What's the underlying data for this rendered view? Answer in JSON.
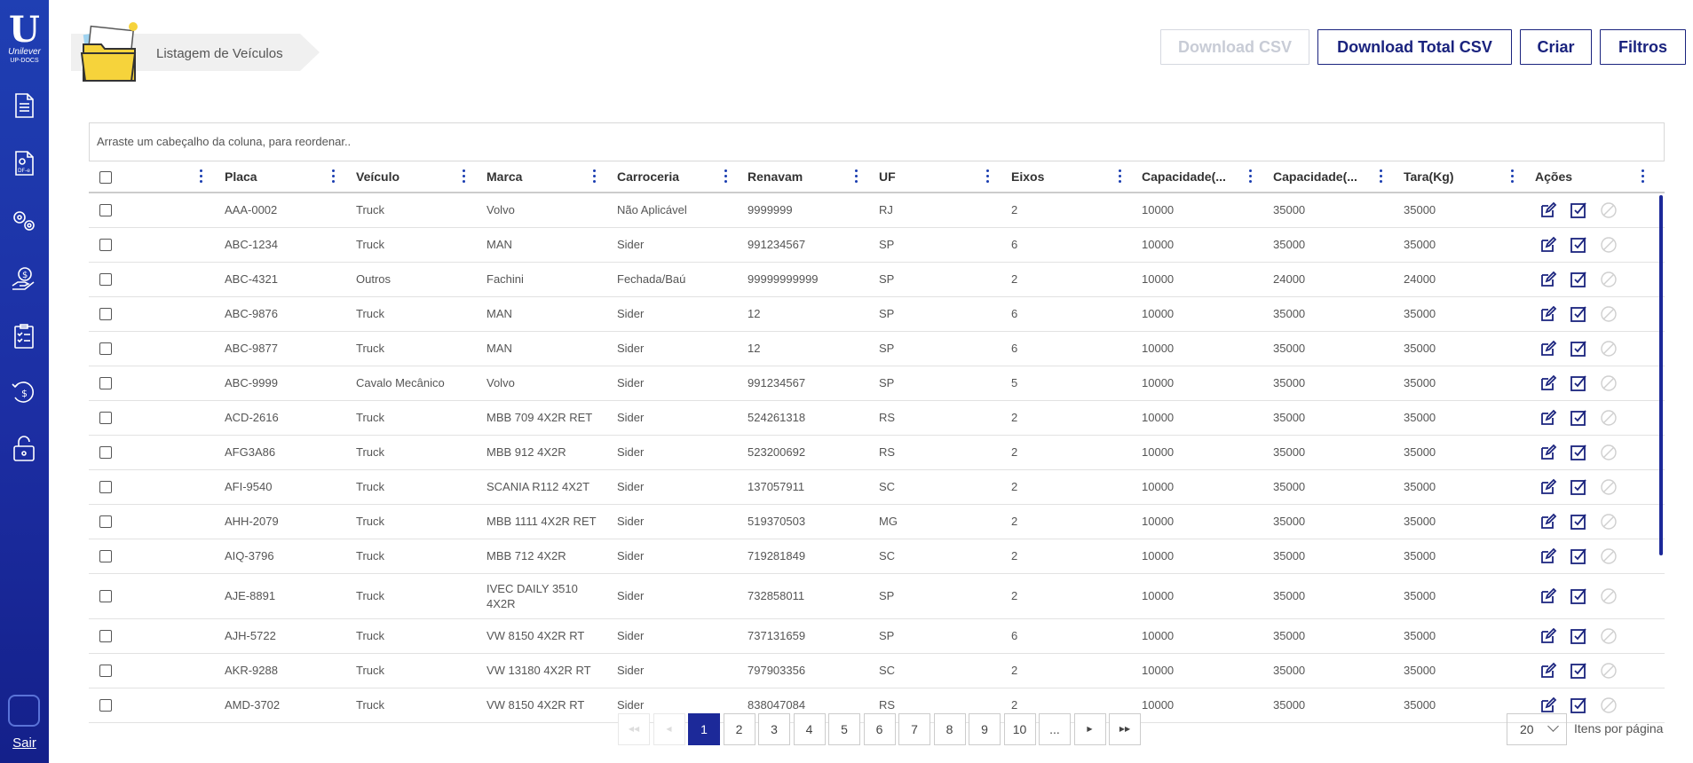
{
  "brand": {
    "name": "Unilever",
    "subtitle": "UP-DOCS",
    "logo_letter": "U"
  },
  "sidebar": {
    "items": [
      {
        "icon": "document-icon"
      },
      {
        "icon": "dfe-document-icon",
        "badge": "DF-e"
      },
      {
        "icon": "settings-gears-icon"
      },
      {
        "icon": "money-hand-icon"
      },
      {
        "icon": "checklist-icon"
      },
      {
        "icon": "refund-dollar-icon"
      },
      {
        "icon": "lock-icon"
      }
    ],
    "exit_label": "Sair"
  },
  "breadcrumb": {
    "title": "Listagem de Veículos"
  },
  "toolbar": {
    "download_csv": "Download CSV",
    "download_total_csv": "Download Total CSV",
    "create": "Criar",
    "filters": "Filtros"
  },
  "grid": {
    "group_panel_text": "Arraste um cabeçalho da coluna, para reordenar..",
    "columns": [
      "Placa",
      "Veículo",
      "Marca",
      "Carroceria",
      "Renavam",
      "UF",
      "Eixos",
      "Capacidade(...",
      "Capacidade(...",
      "Tara(Kg)",
      "Ações"
    ],
    "rows": [
      [
        "AAA-0002",
        "Truck",
        "Volvo",
        "Não Aplicável",
        "9999999",
        "RJ",
        "2",
        "10000",
        "35000",
        "35000"
      ],
      [
        "ABC-1234",
        "Truck",
        "MAN",
        "Sider",
        "991234567",
        "SP",
        "6",
        "10000",
        "35000",
        "35000"
      ],
      [
        "ABC-4321",
        "Outros",
        "Fachini",
        "Fechada/Baú",
        "99999999999",
        "SP",
        "2",
        "10000",
        "24000",
        "24000"
      ],
      [
        "ABC-9876",
        "Truck",
        "MAN",
        "Sider",
        "12",
        "SP",
        "6",
        "10000",
        "35000",
        "35000"
      ],
      [
        "ABC-9877",
        "Truck",
        "MAN",
        "Sider",
        "12",
        "SP",
        "6",
        "10000",
        "35000",
        "35000"
      ],
      [
        "ABC-9999",
        "Cavalo Mecânico",
        "Volvo",
        "Sider",
        "991234567",
        "SP",
        "5",
        "10000",
        "35000",
        "35000"
      ],
      [
        "ACD-2616",
        "Truck",
        "MBB 709 4X2R RET",
        "Sider",
        "524261318",
        "RS",
        "2",
        "10000",
        "35000",
        "35000"
      ],
      [
        "AFG3A86",
        "Truck",
        "MBB 912 4X2R",
        "Sider",
        "523200692",
        "RS",
        "2",
        "10000",
        "35000",
        "35000"
      ],
      [
        "AFI-9540",
        "Truck",
        "SCANIA R112 4X2T",
        "Sider",
        "137057911",
        "SC",
        "2",
        "10000",
        "35000",
        "35000"
      ],
      [
        "AHH-2079",
        "Truck",
        "MBB 1111 4X2R RET",
        "Sider",
        "519370503",
        "MG",
        "2",
        "10000",
        "35000",
        "35000"
      ],
      [
        "AIQ-3796",
        "Truck",
        "MBB 712 4X2R",
        "Sider",
        "719281849",
        "SC",
        "2",
        "10000",
        "35000",
        "35000"
      ],
      [
        "AJE-8891",
        "Truck",
        "IVEC DAILY 3510 4X2R",
        "Sider",
        "732858011",
        "SP",
        "2",
        "10000",
        "35000",
        "35000"
      ],
      [
        "AJH-5722",
        "Truck",
        "VW 8150 4X2R RT",
        "Sider",
        "737131659",
        "SP",
        "6",
        "10000",
        "35000",
        "35000"
      ],
      [
        "AKR-9288",
        "Truck",
        "VW 13180 4X2R RT",
        "Sider",
        "797903356",
        "SC",
        "2",
        "10000",
        "35000",
        "35000"
      ],
      [
        "AMD-3702",
        "Truck",
        "VW 8150 4X2R RT",
        "Sider",
        "838047084",
        "RS",
        "2",
        "10000",
        "35000",
        "35000"
      ]
    ]
  },
  "pagination": {
    "pages": [
      "1",
      "2",
      "3",
      "4",
      "5",
      "6",
      "7",
      "8",
      "9",
      "10",
      "..."
    ],
    "current_page": "1",
    "page_size": "20",
    "page_size_label": "Itens por página"
  },
  "colors": {
    "primary": "#1a237e",
    "sidebar": "#1f3fb3",
    "active_page": "#1c2999"
  }
}
